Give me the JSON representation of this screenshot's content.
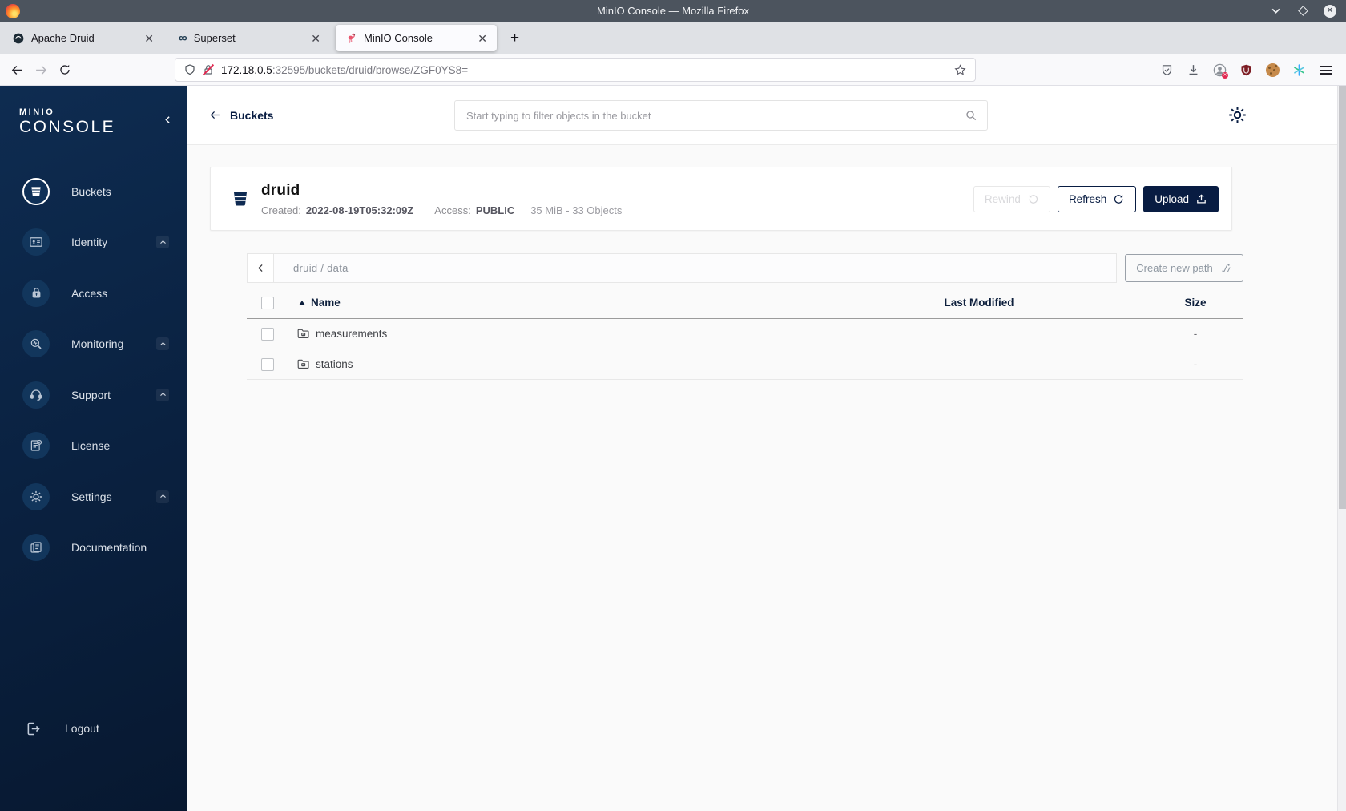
{
  "colors": {
    "brand_navy": "#081C42",
    "sidebar_top": "#0e2c51",
    "sidebar_bottom": "#071830",
    "titlebar_gray": "#4c545e",
    "flamingo_red": "#e8556d",
    "broken_lock_red": "#e22850"
  },
  "titlebar": {
    "title": "MinIO Console — Mozilla Firefox"
  },
  "tabs": [
    {
      "label": "Apache Druid",
      "icon": "druid-icon",
      "active": false
    },
    {
      "label": "Superset",
      "icon": "superset-icon",
      "active": false
    },
    {
      "label": "MinIO Console",
      "icon": "minio-flamingo-icon",
      "active": true
    }
  ],
  "urlbar": {
    "host": "172.18.0.5",
    "path": ":32595/buckets/druid/browse/ZGF0YS8="
  },
  "sidebar": {
    "logo_top": "MINIO",
    "logo_bottom": "CONSOLE",
    "items": [
      {
        "label": "Buckets",
        "icon": "bucket-icon",
        "active": true,
        "expandable": false
      },
      {
        "label": "Identity",
        "icon": "identity-card-icon",
        "active": false,
        "expandable": true
      },
      {
        "label": "Access",
        "icon": "lock-icon",
        "active": false,
        "expandable": false
      },
      {
        "label": "Monitoring",
        "icon": "monitoring-icon",
        "active": false,
        "expandable": true
      },
      {
        "label": "Support",
        "icon": "support-icon",
        "active": false,
        "expandable": true
      },
      {
        "label": "License",
        "icon": "license-icon",
        "active": false,
        "expandable": false
      },
      {
        "label": "Settings",
        "icon": "gear-icon",
        "active": false,
        "expandable": true
      },
      {
        "label": "Documentation",
        "icon": "documentation-icon",
        "active": false,
        "expandable": false
      }
    ],
    "logout": {
      "label": "Logout",
      "icon": "logout-icon"
    }
  },
  "header": {
    "back_label": "Buckets",
    "search_placeholder": "Start typing to filter objects in the bucket"
  },
  "bucket": {
    "name": "druid",
    "created_label": "Created:",
    "created_value": "2022-08-19T05:32:09Z",
    "access_label": "Access:",
    "access_value": "PUBLIC",
    "size_objects": "35 MiB - 33 Objects",
    "buttons": {
      "rewind": "Rewind",
      "refresh": "Refresh",
      "upload": "Upload"
    }
  },
  "path_bar": {
    "breadcrumb": "druid / data",
    "create_new_path": "Create new path"
  },
  "table": {
    "headers": {
      "name": "Name",
      "last_modified": "Last Modified",
      "size": "Size"
    },
    "rows": [
      {
        "name": "measurements",
        "last_modified": "",
        "size": "-"
      },
      {
        "name": "stations",
        "last_modified": "",
        "size": "-"
      }
    ]
  }
}
